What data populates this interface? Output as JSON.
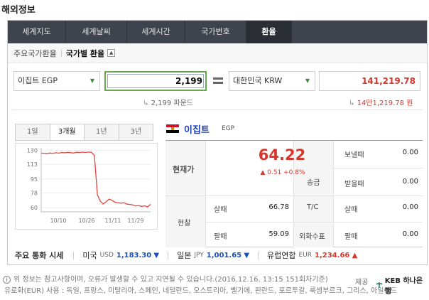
{
  "page_title": "해외정보",
  "tabs": [
    {
      "label": "세계지도",
      "active": false
    },
    {
      "label": "세계날씨",
      "active": false
    },
    {
      "label": "세계시간",
      "active": false
    },
    {
      "label": "국가번호",
      "active": false
    },
    {
      "label": "환율",
      "active": true
    }
  ],
  "subtabs": [
    {
      "label": "주요국가환율",
      "active": false
    },
    {
      "label": "국가별 환율",
      "active": true
    }
  ],
  "collapse_icon": "▲",
  "converter": {
    "from_currency": "이집트 EGP",
    "amount": "2,199",
    "to_currency": "대한민국 KRW",
    "result": "141,219.78",
    "from_hint": "2,199 파운드",
    "to_hint": "14만1,219.78 원",
    "hint_mark": "↳"
  },
  "periods": [
    {
      "label": "1일",
      "active": false
    },
    {
      "label": "3개월",
      "active": true
    },
    {
      "label": "1년",
      "active": false
    },
    {
      "label": "3년",
      "active": false
    }
  ],
  "country": {
    "name": "이집트",
    "code": "EGP"
  },
  "quote": {
    "current_label": "현재가",
    "price": "64.22",
    "change": "▲ 0.51 +0.8%",
    "cash_label": "현찰",
    "buy_label": "살때",
    "sell_label": "팔때",
    "cash_buy": "66.78",
    "cash_sell": "59.09",
    "remit_label": "송금",
    "send_label": "보낼때",
    "receive_label": "받을때",
    "remit_send": "0.00",
    "remit_receive": "0.00",
    "tc_label": "T/C",
    "tc_buy": "0.00",
    "check_label": "외화수표",
    "check_sell": "0.00"
  },
  "majors": {
    "label": "주요 통화 시세",
    "items": [
      {
        "name": "미국",
        "code": "USD",
        "value": "1,183.30",
        "direction": "▼",
        "color": "blue"
      },
      {
        "name": "일본",
        "code": "JPY",
        "value": "1,001.65",
        "direction": "▼",
        "color": "blue"
      },
      {
        "name": "유럽연합",
        "code": "EUR",
        "value": "1,234.66",
        "direction": "▲",
        "color": "red"
      }
    ]
  },
  "footer": {
    "line1": "위 정보는 참고사항이며, 오류가 발생할 수 있고 지연될 수 있습니다.(2016.12.16. 13:15 151회차기준)",
    "line2": "유로화(EUR) 사용 : 독일, 프랑스, 이탈리아, 스페인, 네덜란드, 오스트리아, 벨기에, 핀란드, 포르투갈, 룩셈부르크, 그리스, 아일랜드",
    "provider_label": "제공 :",
    "bank": "KEB 하나은행"
  },
  "chart_data": {
    "type": "line",
    "x_ticks": [
      "10/10",
      "10/26",
      "11/11",
      "11/29"
    ],
    "y_ticks": [
      60,
      78,
      95,
      113,
      130
    ],
    "ylim": [
      55,
      133
    ],
    "grid": true,
    "series": [
      {
        "values": [
          126.5,
          126.5,
          126.2,
          126.8,
          126.4,
          127.0,
          126.6,
          127.2,
          126.9,
          127.5,
          127.1,
          126.8,
          127.6,
          127.3,
          127.8,
          127.4,
          127.9,
          127.5,
          124.0,
          76.0,
          68.0,
          64.5,
          67.5,
          70.5,
          69.0,
          66.5,
          66.2,
          65.6,
          66.1,
          64.4,
          64.0,
          63.5,
          62.2,
          62.8,
          61.6,
          62.4,
          61.0,
          64.22
        ],
        "color": "#e0473f"
      }
    ]
  }
}
